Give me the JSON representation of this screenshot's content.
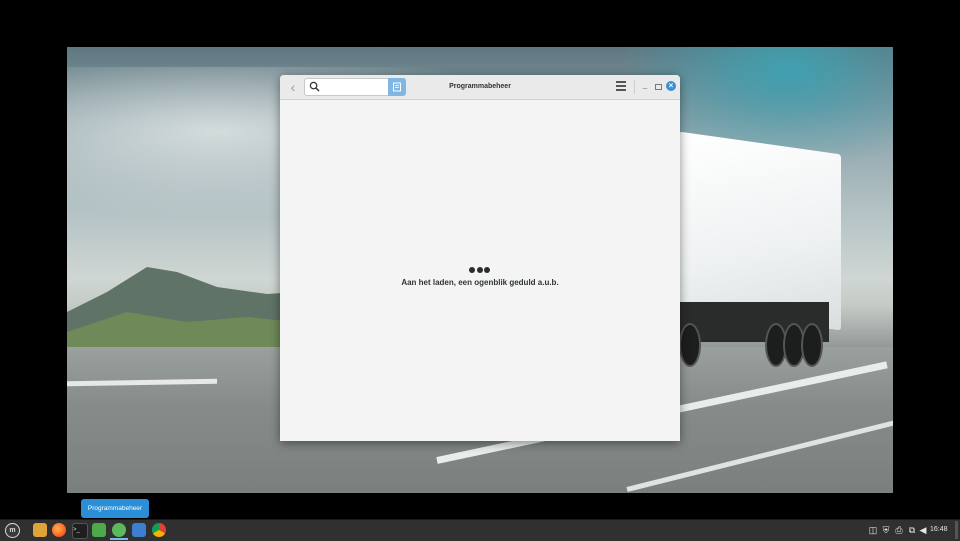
{
  "window": {
    "title": "Programmabeheer",
    "search_placeholder": "",
    "loading_text": "Aan het laden, een ogenblik geduld a.u.b."
  },
  "tooltip": {
    "text": "Programmabeheer"
  },
  "taskbar": {
    "apps": [
      {
        "name": "menu-icon"
      },
      {
        "name": "files-icon"
      },
      {
        "name": "firefox-icon"
      },
      {
        "name": "terminal-icon"
      },
      {
        "name": "shield-icon"
      },
      {
        "name": "software-manager-icon"
      },
      {
        "name": "mail-icon"
      },
      {
        "name": "chrome-icon"
      }
    ],
    "tray": [
      "clipboard-icon",
      "shield-icon",
      "printer-icon",
      "network-icon",
      "volume-icon"
    ],
    "clock": "16:48"
  },
  "colors": {
    "accent": "#2a8fd6",
    "taskbar_bg": "#303030",
    "window_bg": "#f2f2f2"
  }
}
